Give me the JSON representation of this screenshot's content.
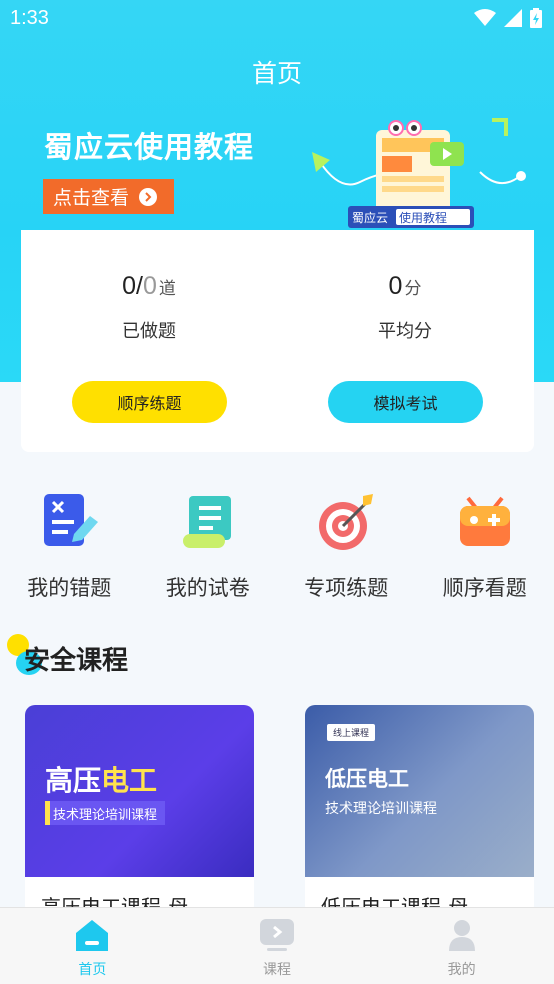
{
  "status_bar": {
    "time": "1:33"
  },
  "header": {
    "title": "首页"
  },
  "banner": {
    "title": "蜀应云使用教程",
    "button_label": "点击查看",
    "tag_left": "蜀应云",
    "tag_right": "使用教程"
  },
  "stats": {
    "done": {
      "value": "0",
      "sep": "/",
      "total": "0",
      "unit": "道",
      "label": "已做题"
    },
    "avg": {
      "value": "0",
      "unit": "分",
      "label": "平均分"
    },
    "buttons": {
      "sequential": "顺序练题",
      "mock": "模拟考试"
    }
  },
  "quick_menu": [
    {
      "label": "我的错题",
      "icon": "wrong-questions-icon"
    },
    {
      "label": "我的试卷",
      "icon": "scroll-paper-icon"
    },
    {
      "label": "专项练题",
      "icon": "target-icon"
    },
    {
      "label": "顺序看题",
      "icon": "gamepad-icon"
    }
  ],
  "section": {
    "title": "安全课程"
  },
  "courses": [
    {
      "thumb_main_a": "高压",
      "thumb_main_b": "电工",
      "thumb_sub": "技术理论培训课程",
      "title": "高压电工课程-母"
    },
    {
      "thumb_badge": "线上课程",
      "thumb_main_a": "低压电工",
      "thumb_main_b": "",
      "thumb_sub": "技术理论培训课程",
      "title": "低压电工课程-母"
    }
  ],
  "tabs": [
    {
      "label": "首页",
      "icon": "home-icon",
      "active": true
    },
    {
      "label": "课程",
      "icon": "course-play-icon",
      "active": false
    },
    {
      "label": "我的",
      "icon": "profile-icon",
      "active": false
    }
  ],
  "colors": {
    "primary": "#25d3f2",
    "accent_yellow": "#ffe000",
    "banner_orange": "#f26b2a"
  }
}
